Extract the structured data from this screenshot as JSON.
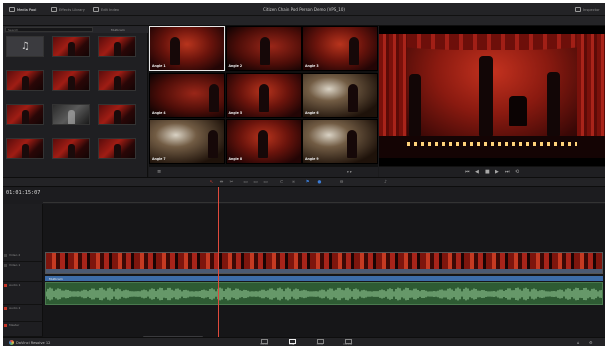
{
  "app": {
    "name": "DaVinci Resolve 12"
  },
  "topbar": {
    "media_pool_label": "Media Pool",
    "effects_label": "Effects Library",
    "edit_index_label": "Edit Index",
    "project_title": "Citizen Chain Pod Person Demo (VPS_10)",
    "inspector_label": "Inspector"
  },
  "subbar": {
    "zoom_left": "",
    "tc_left": "",
    "timeline_name": "",
    "tc_mid": "",
    "zoom_right": "",
    "tc_right": "",
    "record_label": "",
    "tc_far_right": ""
  },
  "media_pool": {
    "bin_label": "Multicam",
    "search_placeholder": "Search",
    "items": [
      {
        "label": "",
        "kind": "music"
      },
      {
        "label": "",
        "kind": "red"
      },
      {
        "label": "",
        "kind": "red"
      },
      {
        "label": "",
        "kind": "red"
      },
      {
        "label": "",
        "kind": "red"
      },
      {
        "label": "",
        "kind": "red"
      },
      {
        "label": "",
        "kind": "red"
      },
      {
        "label": "",
        "kind": "dark"
      },
      {
        "label": "",
        "kind": "red"
      },
      {
        "label": "",
        "kind": "red"
      },
      {
        "label": "",
        "kind": "red"
      },
      {
        "label": "",
        "kind": "red"
      }
    ]
  },
  "multicam": {
    "angles": [
      {
        "label": "Angle 1"
      },
      {
        "label": "Angle 2"
      },
      {
        "label": "Angle 3"
      },
      {
        "label": "Angle 4"
      },
      {
        "label": "Angle 5"
      },
      {
        "label": "Angle 6"
      },
      {
        "label": "Angle 7"
      },
      {
        "label": "Angle 8"
      },
      {
        "label": "Angle 9"
      }
    ]
  },
  "timeline": {
    "timecode": "01:01:15:07",
    "ruler_ticks": [
      "",
      "",
      "",
      "",
      "",
      "",
      "",
      "",
      "",
      ""
    ],
    "tracks": [
      {
        "name": "Video 2",
        "type": "video"
      },
      {
        "name": "Video 1",
        "type": "video"
      },
      {
        "name": "Audio 1",
        "type": "audio"
      },
      {
        "name": "Audio 2",
        "type": "audio"
      },
      {
        "name": "Master",
        "type": "audio"
      }
    ],
    "multicam_label": "Multicam",
    "audio_clip_name": ""
  },
  "pages": [
    {
      "label": "Media",
      "active": false
    },
    {
      "label": "Edit",
      "active": true
    },
    {
      "label": "Color",
      "active": false
    },
    {
      "label": "Deliver",
      "active": false
    }
  ],
  "colors": {
    "playhead": "#e04a3c",
    "multicam_bar": "#3d6ca8",
    "audio_clip": "#2e5b33"
  }
}
